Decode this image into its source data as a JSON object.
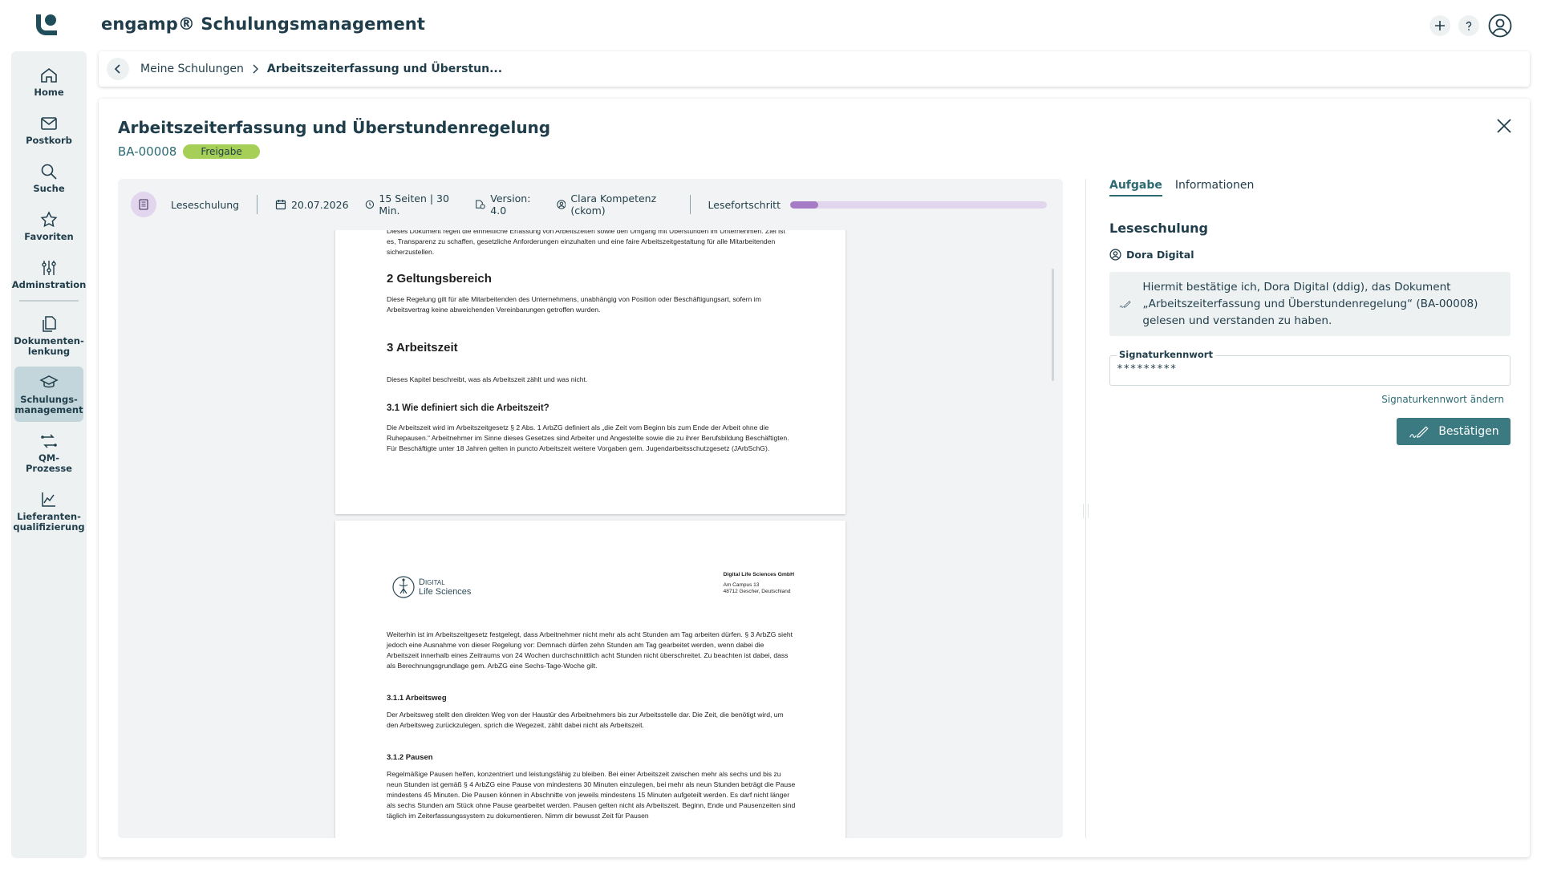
{
  "app": {
    "title": "engamp® Schulungsmanagement"
  },
  "sidebar": {
    "items": [
      {
        "label": "Home"
      },
      {
        "label": "Postkorb"
      },
      {
        "label": "Suche"
      },
      {
        "label": "Favoriten"
      },
      {
        "label": "Adminstration"
      },
      {
        "label": "Dokumenten-\nlenkung"
      },
      {
        "label": "Schulungs-\nmanagement"
      },
      {
        "label": "QM-Prozesse"
      },
      {
        "label": "Lieferanten-\nqualifizierung"
      }
    ]
  },
  "breadcrumb": {
    "parent": "Meine Schulungen",
    "current": "Arbeitszeiterfassung und Überstun..."
  },
  "document": {
    "title": "Arbeitszeiterfassung und Überstundenregelung",
    "id": "BA-00008",
    "status": "Freigabe"
  },
  "viewer": {
    "type": "Leseschulung",
    "date": "20.07.2026",
    "length": "15 Seiten | 30 Min.",
    "version": "Version: 4.0",
    "author": "Clara Kompetenz (ckom)",
    "progress_label": "Lesefortschritt",
    "progress_fraction": 0.11
  },
  "page1": {
    "intro": "Dieses Dokument regelt die einheitliche Erfassung von Arbeitszeiten sowie den Umgang mit Überstunden im Unternehmen. Ziel ist es, Transparenz zu schaffen, gesetzliche Anforderungen einzuhalten und eine faire Arbeitszeitgestaltung für alle Mitarbeitenden sicherzustellen.",
    "h_scope": "2 Geltungsbereich",
    "scope": "Diese Regelung gilt für alle Mitarbeitenden des Unternehmens, unabhängig von Position oder Beschäftigungsart, sofern im Arbeitsvertrag keine abweichenden Vereinbarungen getroffen wurden.",
    "h_worktime": "3 Arbeitszeit",
    "worktime": "Dieses Kapitel beschreibt, was als Arbeitszeit zählt und was nicht.",
    "h_definition": "3.1 Wie definiert sich die Arbeitszeit?",
    "definition": "Die Arbeitszeit wird im Arbeitszeitgesetz § 2 Abs. 1 ArbZG definiert als „die Zeit vom Beginn bis zum Ende der Arbeit ohne die Ruhepausen.“ Arbeitnehmer im Sinne dieses Gesetzes sind Arbeiter und Angestellte sowie die zu ihrer Berufsbildung Beschäftigten. Für Beschäftigte unter 18 Jahren gelten in puncto Arbeitszeit weitere Vorgaben gem. Jugendarbeitsschutzgesetz (JArbSchG)."
  },
  "page2": {
    "logo_line1": "Digital",
    "logo_line2": "Life Sciences",
    "company_name": "Digital Life Sciences GmbH",
    "company_street": "Am Campus 13",
    "company_city": "48712 Gescher, Deutschland",
    "para1": "Weiterhin ist im Arbeitszeitgesetz festgelegt, dass Arbeitnehmer nicht mehr als acht Stunden am Tag arbeiten dürfen. § 3 ArbZG sieht jedoch eine Ausnahme von dieser Regelung vor: Demnach dürfen zehn Stunden am Tag gearbeitet werden, wenn dabei die Arbeitszeit innerhalb eines Zeitraums von 24 Wochen durchschnittlich acht Stunden nicht überschreitet. Zu beachten ist dabei, dass als Berechnungsgrundlage gem. ArbZG eine Sechs-Tage-Woche gilt.",
    "h_commute": "3.1.1 Arbeitsweg",
    "commute": "Der Arbeitsweg stellt den direkten Weg von der Haustür des Arbeitnehmers bis zur Arbeitsstelle dar. Die Zeit, die benötigt wird, um den Arbeitsweg zurückzulegen, sprich die Wegezeit, zählt dabei nicht als Arbeitszeit.",
    "h_breaks": "3.1.2 Pausen",
    "breaks": "Regelmäßige Pausen helfen, konzentriert und leistungsfähig zu bleiben. Bei einer Arbeitszeit zwischen mehr als sechs und bis zu neun Stunden ist gemäß § 4 ArbZG eine Pause von mindestens 30 Minuten einzulegen, bei mehr als neun Stunden beträgt die Pause mindestens 45 Minuten. Die Pausen können in Abschnitte von jeweils mindestens 15 Minuten aufgeteilt werden. Es darf nicht länger als sechs Stunden am Stück ohne Pause gearbeitet werden. Pausen gelten nicht als Arbeitszeit. Beginn, Ende und Pausenzeiten sind täglich im Zeiterfassungssystem zu dokumentieren. Nimm dir bewusst Zeit für Pausen"
  },
  "task": {
    "tabs": [
      {
        "label": "Aufgabe"
      },
      {
        "label": "Informationen"
      }
    ],
    "heading": "Leseschulung",
    "assignee": "Dora Digital",
    "confirmation": "Hiermit bestätige ich, Dora Digital (ddig), das Dokument „Arbeitszeiterfassung und Überstundenregelung“ (BA-00008) gelesen und verstanden zu haben.",
    "password_label": "Signaturkennwort",
    "password_value": "*********",
    "change_password": "Signaturkennwort ändern",
    "confirm_button": "Bestätigen"
  },
  "colors": {
    "primary": "#3a7a80",
    "status_green": "#a5cf56",
    "progress": "#a77cc6",
    "sidebar_bg": "#eef1f2",
    "active_nav": "#c3d6db"
  }
}
